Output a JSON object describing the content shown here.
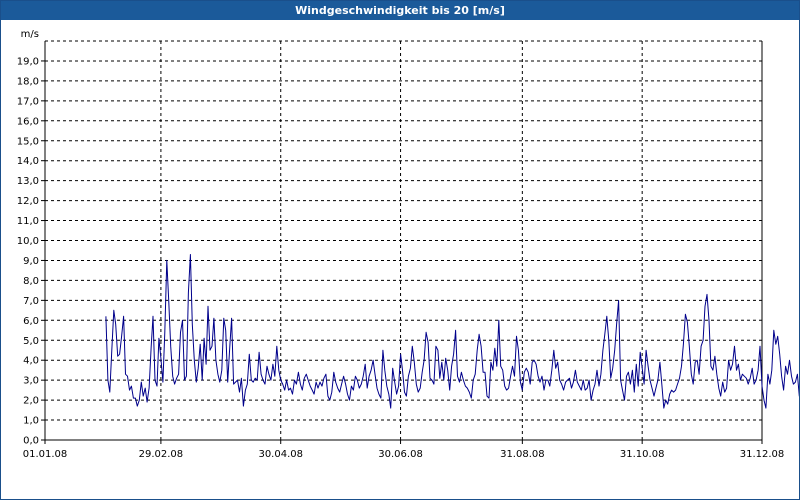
{
  "window": {
    "title": "Windgeschwindigkeit bis 20 [m/s]"
  },
  "colors": {
    "titlebar": "#1b5a9a",
    "series": "#00008b",
    "grid": "#000000"
  },
  "chart_data": {
    "type": "line",
    "title": "Windgeschwindigkeit bis 20 [m/s]",
    "ylabel": "m/s",
    "ylim": [
      0,
      20
    ],
    "ytick_labels": [
      "0,0",
      "1,0",
      "2,0",
      "3,0",
      "4,0",
      "5,0",
      "6,0",
      "7,0",
      "8,0",
      "9,0",
      "10,0",
      "11,0",
      "12,0",
      "13,0",
      "14,0",
      "15,0",
      "16,0",
      "17,0",
      "18,0",
      "19,0"
    ],
    "xlim": [
      "2008-01-01",
      "2008-12-31"
    ],
    "xtick_labels": [
      "01.01.08",
      "29.02.08",
      "30.04.08",
      "30.06.08",
      "31.08.08",
      "31.10.08",
      "31.12.08"
    ],
    "xtick_dates": [
      "2008-01-01",
      "2008-02-29",
      "2008-04-30",
      "2008-06-30",
      "2008-08-31",
      "2008-10-31",
      "2008-12-31"
    ],
    "grid": true,
    "series": [
      {
        "x_start": "2008-02-01",
        "x_step_days": 1,
        "values": [
          6.2,
          3.0,
          2.4,
          4.5,
          6.5,
          5.8,
          4.2,
          4.3,
          5.2,
          6.2,
          3.3,
          3.2,
          2.5,
          2.7,
          2.1,
          2.1,
          1.7,
          2.0,
          2.9,
          2.2,
          2.6,
          1.9,
          2.6,
          4.6,
          6.2,
          3.0,
          2.7,
          5.1,
          4.1,
          2.9,
          5.4,
          9.0,
          6.9,
          4.7,
          3.2,
          2.8,
          3.1,
          3.3,
          5.4,
          6.0,
          3.0,
          3.2,
          7.4,
          9.3,
          5.8,
          4.0,
          2.9,
          3.6,
          4.8,
          3.0,
          5.1,
          3.8,
          6.7,
          4.5,
          4.7,
          6.1,
          4.0,
          3.3,
          2.9,
          3.5,
          6.1,
          5.5,
          2.9,
          4.6,
          6.1,
          2.8,
          2.9,
          3.0,
          2.4,
          3.1,
          1.7,
          2.5,
          2.8,
          4.3,
          3.0,
          2.9,
          3.1,
          3.0,
          4.4,
          3.3,
          3.0,
          2.8,
          3.7,
          3.3,
          3.0,
          3.8,
          3.2,
          4.7,
          3.5,
          3.0,
          2.8,
          2.5,
          3.0,
          2.5,
          2.6,
          2.3,
          3.0,
          2.8,
          3.4,
          2.8,
          2.5,
          3.1,
          3.3,
          3.0,
          2.7,
          2.5,
          2.3,
          2.9,
          2.6,
          2.9,
          2.7,
          3.1,
          3.3,
          2.2,
          2.0,
          2.4,
          3.4,
          2.9,
          2.6,
          2.4,
          2.8,
          3.2,
          2.8,
          2.3,
          2.0,
          2.7,
          2.5,
          3.2,
          3.0,
          2.6,
          2.8,
          3.2,
          3.8,
          2.6,
          3.2,
          3.5,
          4.0,
          3.3,
          2.6,
          2.3,
          2.1,
          4.5,
          3.5,
          2.7,
          2.3,
          1.6,
          3.6,
          2.9,
          2.3,
          2.7,
          4.3,
          3.5,
          2.4,
          2.2,
          3.2,
          3.6,
          4.7,
          3.9,
          2.8,
          2.4,
          2.6,
          3.4,
          4.0,
          5.4,
          4.9,
          3.1,
          3.0,
          2.8,
          4.7,
          4.5,
          3.1,
          3.9,
          3.0,
          4.1,
          3.5,
          2.5,
          3.7,
          4.3,
          5.5,
          3.2,
          2.9,
          3.4,
          3.0,
          2.7,
          2.6,
          2.4,
          2.1,
          3.0,
          3.3,
          4.5,
          5.3,
          4.7,
          3.4,
          3.4,
          2.2,
          2.1,
          3.9,
          3.5,
          4.6,
          3.7,
          6.0,
          3.7,
          3.5,
          2.7,
          2.5,
          2.6,
          3.2,
          3.7,
          3.2,
          5.2,
          4.5,
          2.9,
          2.5,
          3.4,
          3.6,
          3.4,
          2.8,
          3.9,
          4.0,
          3.8,
          3.2,
          2.9,
          3.2,
          2.5,
          3.0,
          3.0,
          2.7,
          3.5,
          4.5,
          3.6,
          3.9,
          3.0,
          2.8,
          2.5,
          2.9,
          3.0,
          3.1,
          2.6,
          2.9,
          3.5,
          2.9,
          2.7,
          2.5,
          3.0,
          2.5,
          2.6,
          3.0,
          2.0,
          2.5,
          2.8,
          3.5,
          2.7,
          3.3,
          4.5,
          5.3,
          6.2,
          5.0,
          3.1,
          3.6,
          4.5,
          5.8,
          7.0,
          3.0,
          2.5,
          2.0,
          3.2,
          3.4,
          2.8,
          3.5,
          2.4,
          3.8,
          2.7,
          4.4,
          3.6,
          2.8,
          4.5,
          3.7,
          3.0,
          2.6,
          2.2,
          2.6,
          3.0,
          3.9,
          2.8,
          1.6,
          2.0,
          1.8,
          2.3,
          2.5,
          2.4,
          2.5,
          2.8,
          3.1,
          3.7,
          4.8,
          6.3,
          5.9,
          4.7,
          3.3,
          2.8,
          3.9,
          4.0,
          3.3,
          4.7,
          5.0,
          6.7,
          7.3,
          6.0,
          3.7,
          3.5,
          4.2,
          3.3,
          2.6,
          2.2,
          2.9,
          2.4,
          2.6,
          4.0,
          3.5,
          3.8,
          4.7,
          3.5,
          3.8,
          3.0,
          3.3,
          3.2,
          3.1,
          2.8,
          3.1,
          3.6,
          2.8,
          3.0,
          3.5,
          4.7,
          2.7,
          2.0,
          1.6,
          3.3,
          2.8,
          3.5,
          5.5,
          4.8,
          5.2,
          4.3,
          3.2,
          2.5,
          3.7,
          3.3,
          4.0,
          3.2,
          2.8,
          2.9,
          3.3,
          2.2,
          3.4
        ]
      }
    ]
  }
}
